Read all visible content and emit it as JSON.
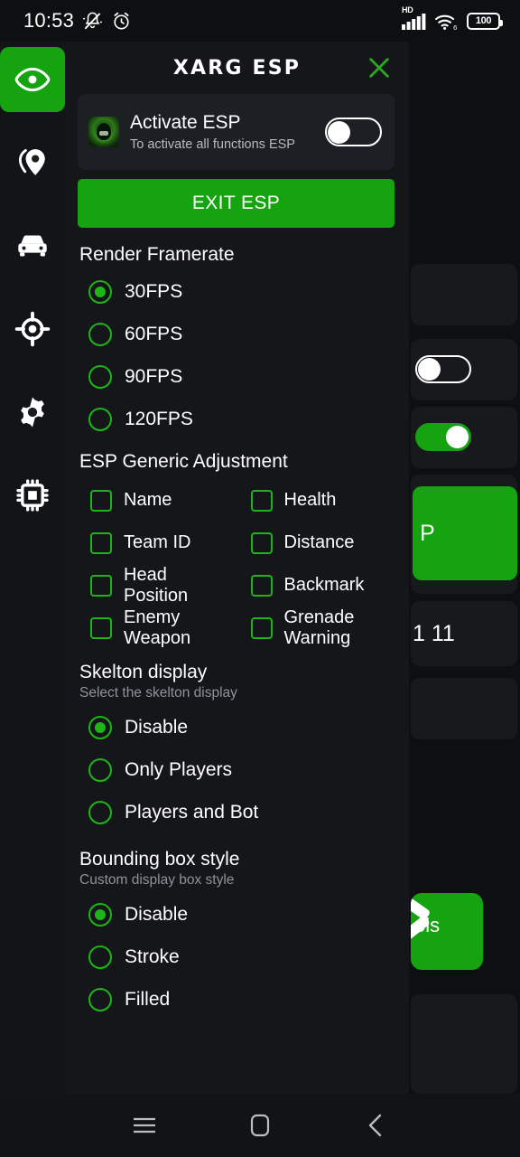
{
  "status_bar": {
    "time": "10:53",
    "icons": [
      "mute-bell-icon",
      "alarm-clock-icon"
    ],
    "network_label": "HD",
    "signal_icon": "cellular-signal-icon",
    "wifi_icon": "wifi-6-icon",
    "battery_level": "100"
  },
  "sidebar": {
    "items": [
      {
        "name": "eye-icon",
        "label": "ESP",
        "active": true
      },
      {
        "name": "location-pin-icon",
        "label": "Location",
        "active": false
      },
      {
        "name": "car-icon",
        "label": "Vehicle",
        "active": false
      },
      {
        "name": "crosshair-icon",
        "label": "Aim",
        "active": false
      },
      {
        "name": "gear-icon",
        "label": "Settings",
        "active": false
      },
      {
        "name": "cpu-chip-icon",
        "label": "System",
        "active": false
      }
    ]
  },
  "panel": {
    "title": "XARG ESP",
    "close_label": "Close",
    "activate": {
      "title": "Activate ESP",
      "subtitle": "To activate all functions ESP",
      "toggle_state": "off"
    },
    "exit_button": "EXIT ESP",
    "sections": [
      {
        "id": "render-framerate",
        "title": "Render Framerate",
        "subtitle": "",
        "type": "radio",
        "options": [
          {
            "label": "30FPS",
            "selected": true
          },
          {
            "label": "60FPS",
            "selected": false
          },
          {
            "label": "90FPS",
            "selected": false
          },
          {
            "label": "120FPS",
            "selected": false
          }
        ]
      },
      {
        "id": "esp-generic-adjustment",
        "title": "ESP Generic Adjustment",
        "subtitle": "",
        "type": "checkbox",
        "options": [
          {
            "label": "Name",
            "checked": false
          },
          {
            "label": "Health",
            "checked": false
          },
          {
            "label": "Team ID",
            "checked": false
          },
          {
            "label": "Distance",
            "checked": false
          },
          {
            "label": "Head Position",
            "checked": false
          },
          {
            "label": "Backmark",
            "checked": false
          },
          {
            "label": "Enemy Weapon",
            "checked": false
          },
          {
            "label": "Grenade Warning",
            "checked": false
          }
        ]
      },
      {
        "id": "skelton-display",
        "title": "Skelton display",
        "subtitle": "Select the skelton display",
        "type": "radio",
        "options": [
          {
            "label": "Disable",
            "selected": true
          },
          {
            "label": "Only Players",
            "selected": false
          },
          {
            "label": "Players and Bot",
            "selected": false
          }
        ]
      },
      {
        "id": "bounding-box-style",
        "title": "Bounding box style",
        "subtitle": "Custom display box style",
        "type": "radio",
        "options": [
          {
            "label": "Disable",
            "selected": true
          },
          {
            "label": "Stroke",
            "selected": false
          },
          {
            "label": "Filled",
            "selected": false
          }
        ]
      }
    ]
  },
  "background_app": {
    "partial_texts": {
      "green_button_fragment": "P",
      "row_fragment": "1 11",
      "tools_fragment": "ols"
    }
  },
  "nav_bar": {
    "buttons": [
      {
        "name": "recents-icon",
        "label": "Recents"
      },
      {
        "name": "home-icon",
        "label": "Home"
      },
      {
        "name": "back-icon",
        "label": "Back"
      }
    ]
  },
  "colors": {
    "accent_green": "#15a30f",
    "control_green": "#1db517",
    "panel_bg": "#141619",
    "card_bg": "#1c1f23",
    "screen_bg": "#0d0f11"
  }
}
